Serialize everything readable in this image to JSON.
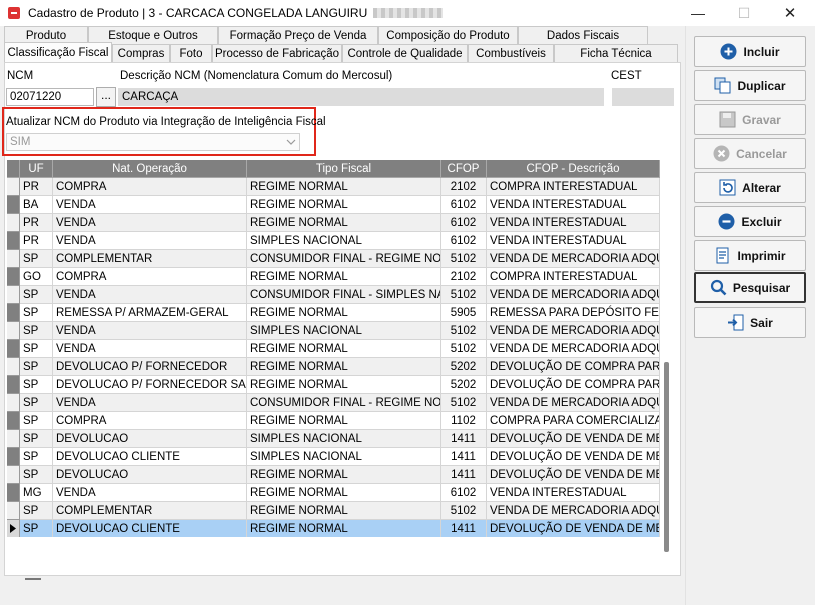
{
  "window": {
    "title": "Cadastro de Produto | 3 - CARCACA CONGELADA LANGUIRU",
    "minimize_glyph": "—",
    "maximize_glyph": "☐",
    "close_glyph": "✕"
  },
  "tabs_top": [
    "Produto",
    "Estoque e Outros",
    "Formação Preço de Venda",
    "Composição do Produto",
    "Dados Fiscais"
  ],
  "tabs_bottom": [
    "Classificação Fiscal",
    "Compras",
    "Foto",
    "Processo de Fabricação",
    "Controle de Qualidade",
    "Combustíveis",
    "Ficha Técnica"
  ],
  "active_tab": "Classificação Fiscal",
  "form": {
    "ncm_label": "NCM",
    "ncm_value": "02071220",
    "dots_label": "...",
    "desc_label": "Descrição NCM (Nomenclatura Comum do Mercosul)",
    "desc_value": "CARCAÇA",
    "cest_label": "CEST",
    "cest_value": "",
    "atualizar_label": "Atualizar NCM do Produto via Integração de Inteligência Fiscal",
    "atualizar_value": "SIM"
  },
  "grid": {
    "columns": [
      "UF",
      "Nat. Operação",
      "Tipo Fiscal",
      "CFOP",
      "CFOP - Descrição"
    ],
    "rows": [
      [
        "PR",
        "COMPRA",
        "REGIME NORMAL",
        "2102",
        "COMPRA INTERESTADUAL"
      ],
      [
        "BA",
        "VENDA",
        "REGIME NORMAL",
        "6102",
        "VENDA INTERESTADUAL"
      ],
      [
        "PR",
        "VENDA",
        "REGIME NORMAL",
        "6102",
        "VENDA INTERESTADUAL"
      ],
      [
        "PR",
        "VENDA",
        "SIMPLES NACIONAL",
        "6102",
        "VENDA INTERESTADUAL"
      ],
      [
        "SP",
        "COMPLEMENTAR",
        "CONSUMIDOR FINAL - REGIME NORM",
        "5102",
        "VENDA DE MERCADORIA ADQUIR"
      ],
      [
        "GO",
        "COMPRA",
        "REGIME NORMAL",
        "2102",
        "COMPRA INTERESTADUAL"
      ],
      [
        "SP",
        "VENDA",
        "CONSUMIDOR FINAL - SIMPLES NACI",
        "5102",
        "VENDA DE MERCADORIA ADQUIR"
      ],
      [
        "SP",
        "REMESSA P/ ARMAZEM-GERAL",
        "REGIME NORMAL",
        "5905",
        "REMESSA PARA DEPÓSITO FECH"
      ],
      [
        "SP",
        "VENDA",
        "SIMPLES NACIONAL",
        "5102",
        "VENDA DE MERCADORIA ADQUIR"
      ],
      [
        "SP",
        "VENDA",
        "REGIME NORMAL",
        "5102",
        "VENDA DE MERCADORIA ADQUIR"
      ],
      [
        "SP",
        "DEVOLUCAO P/ FORNECEDOR",
        "REGIME NORMAL",
        "5202",
        "DEVOLUÇÃO DE COMPRA PARA C"
      ],
      [
        "SP",
        "DEVOLUCAO P/ FORNECEDOR SAIDA",
        "REGIME NORMAL",
        "5202",
        "DEVOLUÇÃO DE COMPRA PARA C"
      ],
      [
        "SP",
        "VENDA",
        "CONSUMIDOR FINAL - REGIME NORM",
        "5102",
        "VENDA DE MERCADORIA ADQUIR"
      ],
      [
        "SP",
        "COMPRA",
        "REGIME NORMAL",
        "1102",
        "COMPRA PARA COMERCIALIZAÇÃ"
      ],
      [
        "SP",
        "DEVOLUCAO",
        "SIMPLES NACIONAL",
        "1411",
        "DEVOLUÇÃO DE VENDA DE MERC"
      ],
      [
        "SP",
        "DEVOLUCAO CLIENTE",
        "SIMPLES NACIONAL",
        "1411",
        "DEVOLUÇÃO DE VENDA DE MERC"
      ],
      [
        "SP",
        "DEVOLUCAO",
        "REGIME NORMAL",
        "1411",
        "DEVOLUÇÃO DE VENDA DE MERC"
      ],
      [
        "MG",
        "VENDA",
        "REGIME NORMAL",
        "6102",
        "VENDA INTERESTADUAL"
      ],
      [
        "SP",
        "COMPLEMENTAR",
        "REGIME NORMAL",
        "5102",
        "VENDA DE MERCADORIA ADQUIR"
      ],
      [
        "SP",
        "DEVOLUCAO CLIENTE",
        "REGIME NORMAL",
        "1411",
        "DEVOLUÇÃO DE VENDA DE MERC"
      ]
    ],
    "selected_row": 19
  },
  "buttons": [
    {
      "label": "Incluir",
      "icon": "plus-circle-icon",
      "enabled": true
    },
    {
      "label": "Duplicar",
      "icon": "duplicate-icon",
      "enabled": true
    },
    {
      "label": "Gravar",
      "icon": "save-icon",
      "enabled": false
    },
    {
      "label": "Cancelar",
      "icon": "cancel-icon",
      "enabled": false
    },
    {
      "label": "Alterar",
      "icon": "refresh-icon",
      "enabled": true
    },
    {
      "label": "Excluir",
      "icon": "minus-circle-icon",
      "enabled": true
    },
    {
      "label": "Imprimir",
      "icon": "print-icon",
      "enabled": true
    },
    {
      "label": "Pesquisar",
      "icon": "search-icon",
      "enabled": true
    },
    {
      "label": "Sair",
      "icon": "exit-icon",
      "enabled": true
    }
  ],
  "colors": {
    "highlight_border": "#e0271a",
    "grid_header": "#808080",
    "selected_row": "#a9d0f5",
    "accent_blue": "#1f5fa8"
  }
}
